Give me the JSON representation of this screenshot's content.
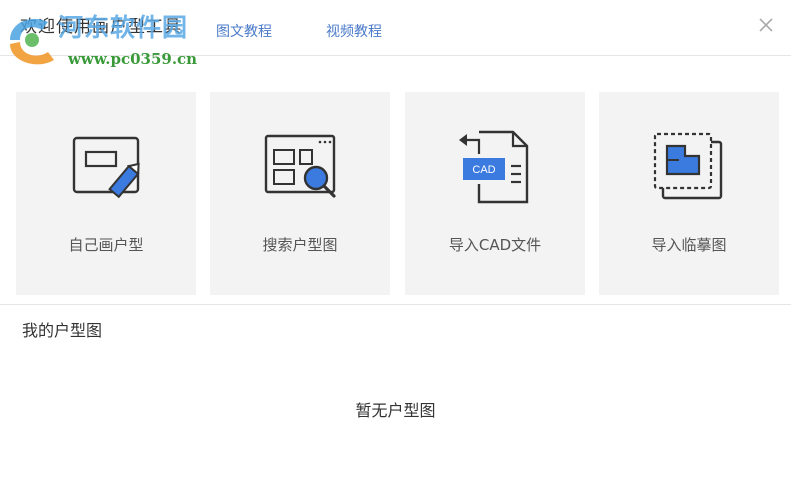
{
  "header": {
    "title": "欢迎使用画户型工具",
    "tabs": [
      {
        "label": "图文教程"
      },
      {
        "label": "视频教程"
      }
    ]
  },
  "watermark": {
    "text": "河东软件园",
    "url": "www.pc0359.cn"
  },
  "cards": [
    {
      "label": "自己画户型",
      "icon": "draw-floorplan-icon"
    },
    {
      "label": "搜索户型图",
      "icon": "search-floorplan-icon"
    },
    {
      "label": "导入CAD文件",
      "icon": "import-cad-icon",
      "badge": "CAD"
    },
    {
      "label": "导入临摹图",
      "icon": "import-trace-icon"
    }
  ],
  "my_floorplans": {
    "title": "我的户型图",
    "empty_text": "暂无户型图"
  },
  "colors": {
    "accent": "#3b7be0",
    "link": "#4b7bc9",
    "card_bg": "#f3f3f3",
    "icon_stroke": "#333333"
  }
}
